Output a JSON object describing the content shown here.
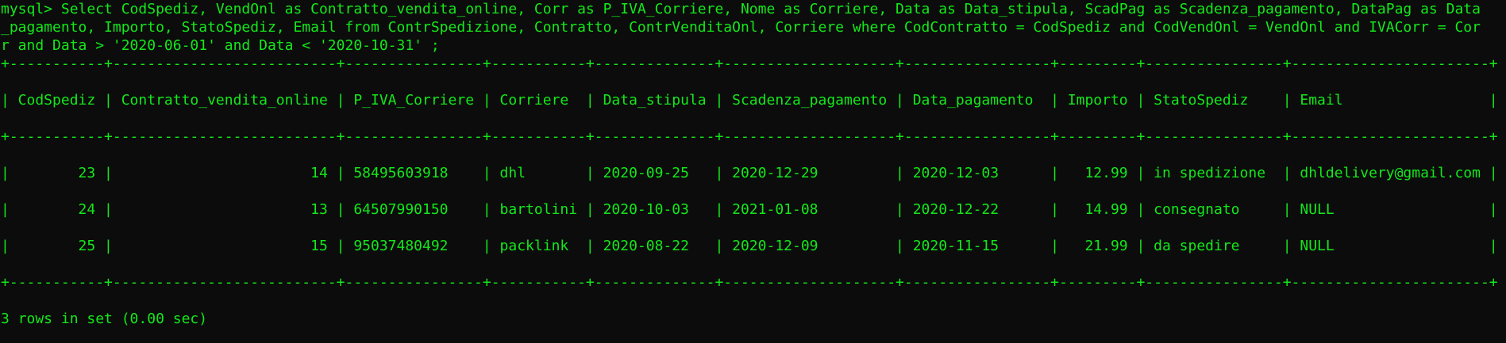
{
  "terminal": {
    "query_lines": [
      "mysql> Select CodSpediz, VendOnl as Contratto_vendita_online, Corr as P_IVA_Corriere, Nome as Corriere, Data as Data_stipula, ScadPag as Scadenza_pagamento, DataPag as Data",
      "_pagamento, Importo, StatoSpediz, Email from ContrSpedizione, Contratto, ContrVenditaOnl, Corriere where CodContratto = CodSpediz and CodVendOnl = VendOnl and IVACorr = Cor",
      "r and Data > '2020-06-01' and Data < '2020-10-31' ;"
    ],
    "separator": "+-----------+--------------------------+----------------+-----------+--------------+--------------------+-----------------+---------+----------------+-----------------------+",
    "header": "| CodSpediz | Contratto_vendita_online | P_IVA_Corriere | Corriere  | Data_stipula | Scadenza_pagamento | Data_pagamento  | Importo | StatoSpediz    | Email                 |",
    "rows": [
      "|        23 |                       14 | 58495603918    | dhl       | 2020-09-25   | 2020-12-29         | 2020-12-03      |   12.99 | in spedizione  | dhldelivery@gmail.com |",
      "|        24 |                       13 | 64507990150    | bartolini | 2020-10-03   | 2021-01-08         | 2020-12-22      |   14.99 | consegnato     | NULL                  |",
      "|        25 |                       15 | 95037480492    | packlink  | 2020-08-22   | 2020-12-09         | 2020-11-15      |   21.99 | da spedire     | NULL                  |"
    ],
    "result_summary": "3 rows in set (0.00 sec)",
    "colors": {
      "background": "#0c0c0c",
      "text": "#13e81a"
    }
  }
}
